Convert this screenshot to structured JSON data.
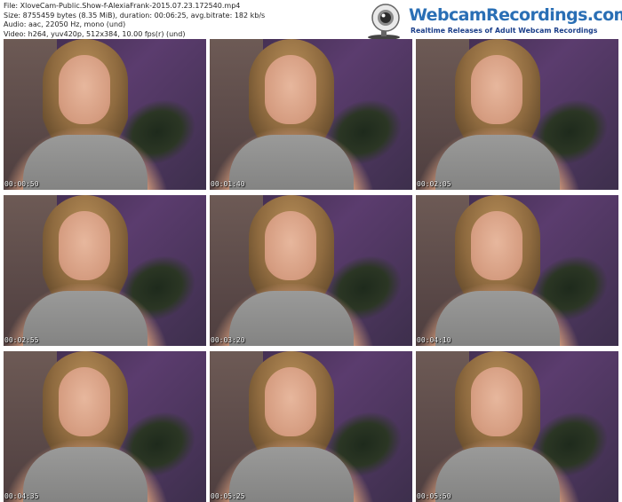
{
  "meta": {
    "file": "File: XloveCam-Public.Show-f-AlexiaFrank-2015.07.23.172540.mp4",
    "size": "Size: 8755459 bytes (8.35 MiB), duration: 00:06:25, avg.bitrate: 182 kb/s",
    "audio": "Audio: aac, 22050 Hz, mono (und)",
    "video": "Video: h264, yuv420p, 512x384, 10.00 fps(r) (und)"
  },
  "brand": {
    "title": "WebcamRecordings.com",
    "tagline": "Realtime Releases of Adult Webcam Recordings",
    "color": "#2a6fb5"
  },
  "thumbnails": [
    {
      "time": "00:00:50"
    },
    {
      "time": "00:01:40"
    },
    {
      "time": "00:02:05"
    },
    {
      "time": "00:02:55"
    },
    {
      "time": "00:03:20"
    },
    {
      "time": "00:04:10"
    },
    {
      "time": "00:04:35"
    },
    {
      "time": "00:05:25"
    },
    {
      "time": "00:05:50"
    }
  ]
}
